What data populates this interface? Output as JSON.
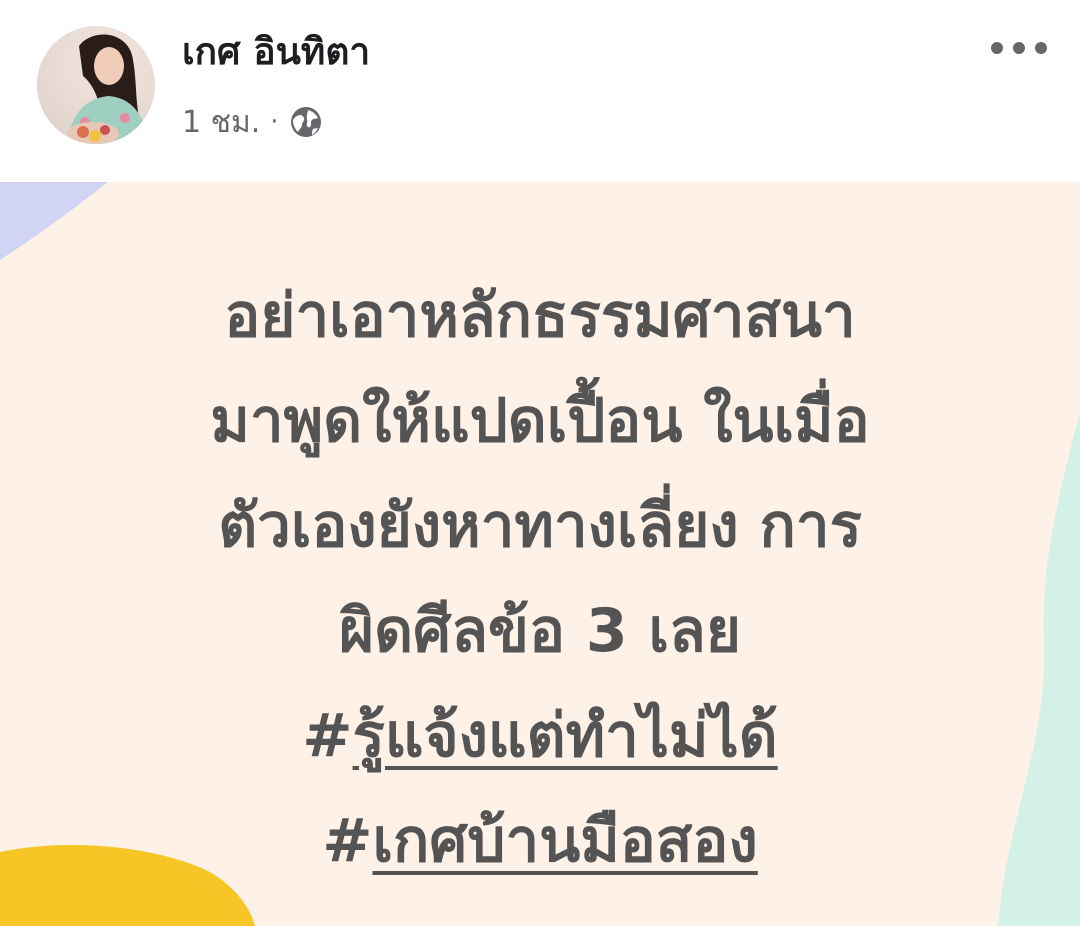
{
  "post": {
    "author": "เกศ อินทิตา",
    "time": "1 ชม.",
    "separator": "·",
    "audience_icon": "globe-icon",
    "more_icon": "more-horizontal-icon"
  },
  "content": {
    "lines": [
      "อย่าเอาหลักธรรมศาสนา",
      "มาพูดให้แปดเปื้อน ในเมื่อ",
      "ตัวเองยังหาทางเลี่ยง การ",
      "ผิดศีลข้อ 3 เลย"
    ],
    "hashtags": [
      {
        "hash": "#",
        "text": "รู้แจ้งแต่ทำไม่ได้"
      },
      {
        "hash": "#",
        "text": "เกศบ้านมือสอง"
      }
    ]
  },
  "colors": {
    "background": "#fdf1e8",
    "text": "#545454",
    "accent_blue": "#d2d4f6",
    "accent_yellow": "#f6c626",
    "accent_mint": "#d4f1e7"
  }
}
